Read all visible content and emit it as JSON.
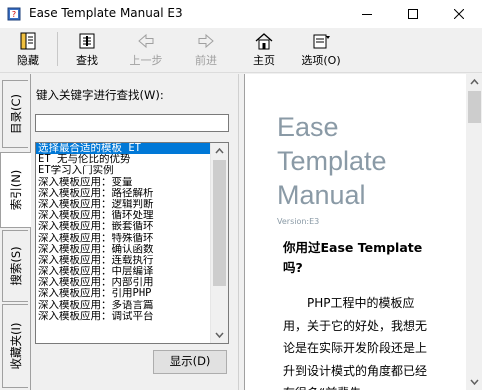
{
  "window": {
    "title": "Ease Template Manual E3"
  },
  "toolbar": {
    "hide_label": "隐藏",
    "find_label": "查找",
    "back_label": "上一步",
    "forward_label": "前进",
    "home_label": "主页",
    "options_label": "选项(O)"
  },
  "tabs": [
    "目录(C)",
    "索引(N)",
    "搜索(S)",
    "收藏夹(I)"
  ],
  "search": {
    "label": "键入关键字进行查找(W):",
    "value": ""
  },
  "index_list": [
    "选择最合适的模板 ET",
    "ET 无与伦比的优势",
    "ET学习入门实例",
    "深入模板应用：变量",
    "深入模板应用：路径解析",
    "深入模板应用：逻辑判断",
    "深入模板应用：循环处理",
    "深入模板应用：嵌套循环",
    "深入模板应用：特殊循环",
    "深入模板应用：确认函数",
    "深入模板应用：连载执行",
    "深入模板应用：中层编译",
    "深入模板应用：内部引用",
    "深入模板应用：引用PHP",
    "深入模板应用：多语言篇",
    "深入模板应用：调试平台"
  ],
  "display_button": "显示(D)",
  "document": {
    "title": "Ease Template Manual",
    "version": "Version:E3",
    "heading": "你用过Ease Template吗?",
    "paragraph": "PHP工程中的模板应用，关于它的好处，我想无论是在实际开发阶段还是上升到设计模式的角度都已经有很多“前辈先"
  },
  "colors": {
    "selection": "#0078d7",
    "doc_title": "#8a9aa6"
  }
}
